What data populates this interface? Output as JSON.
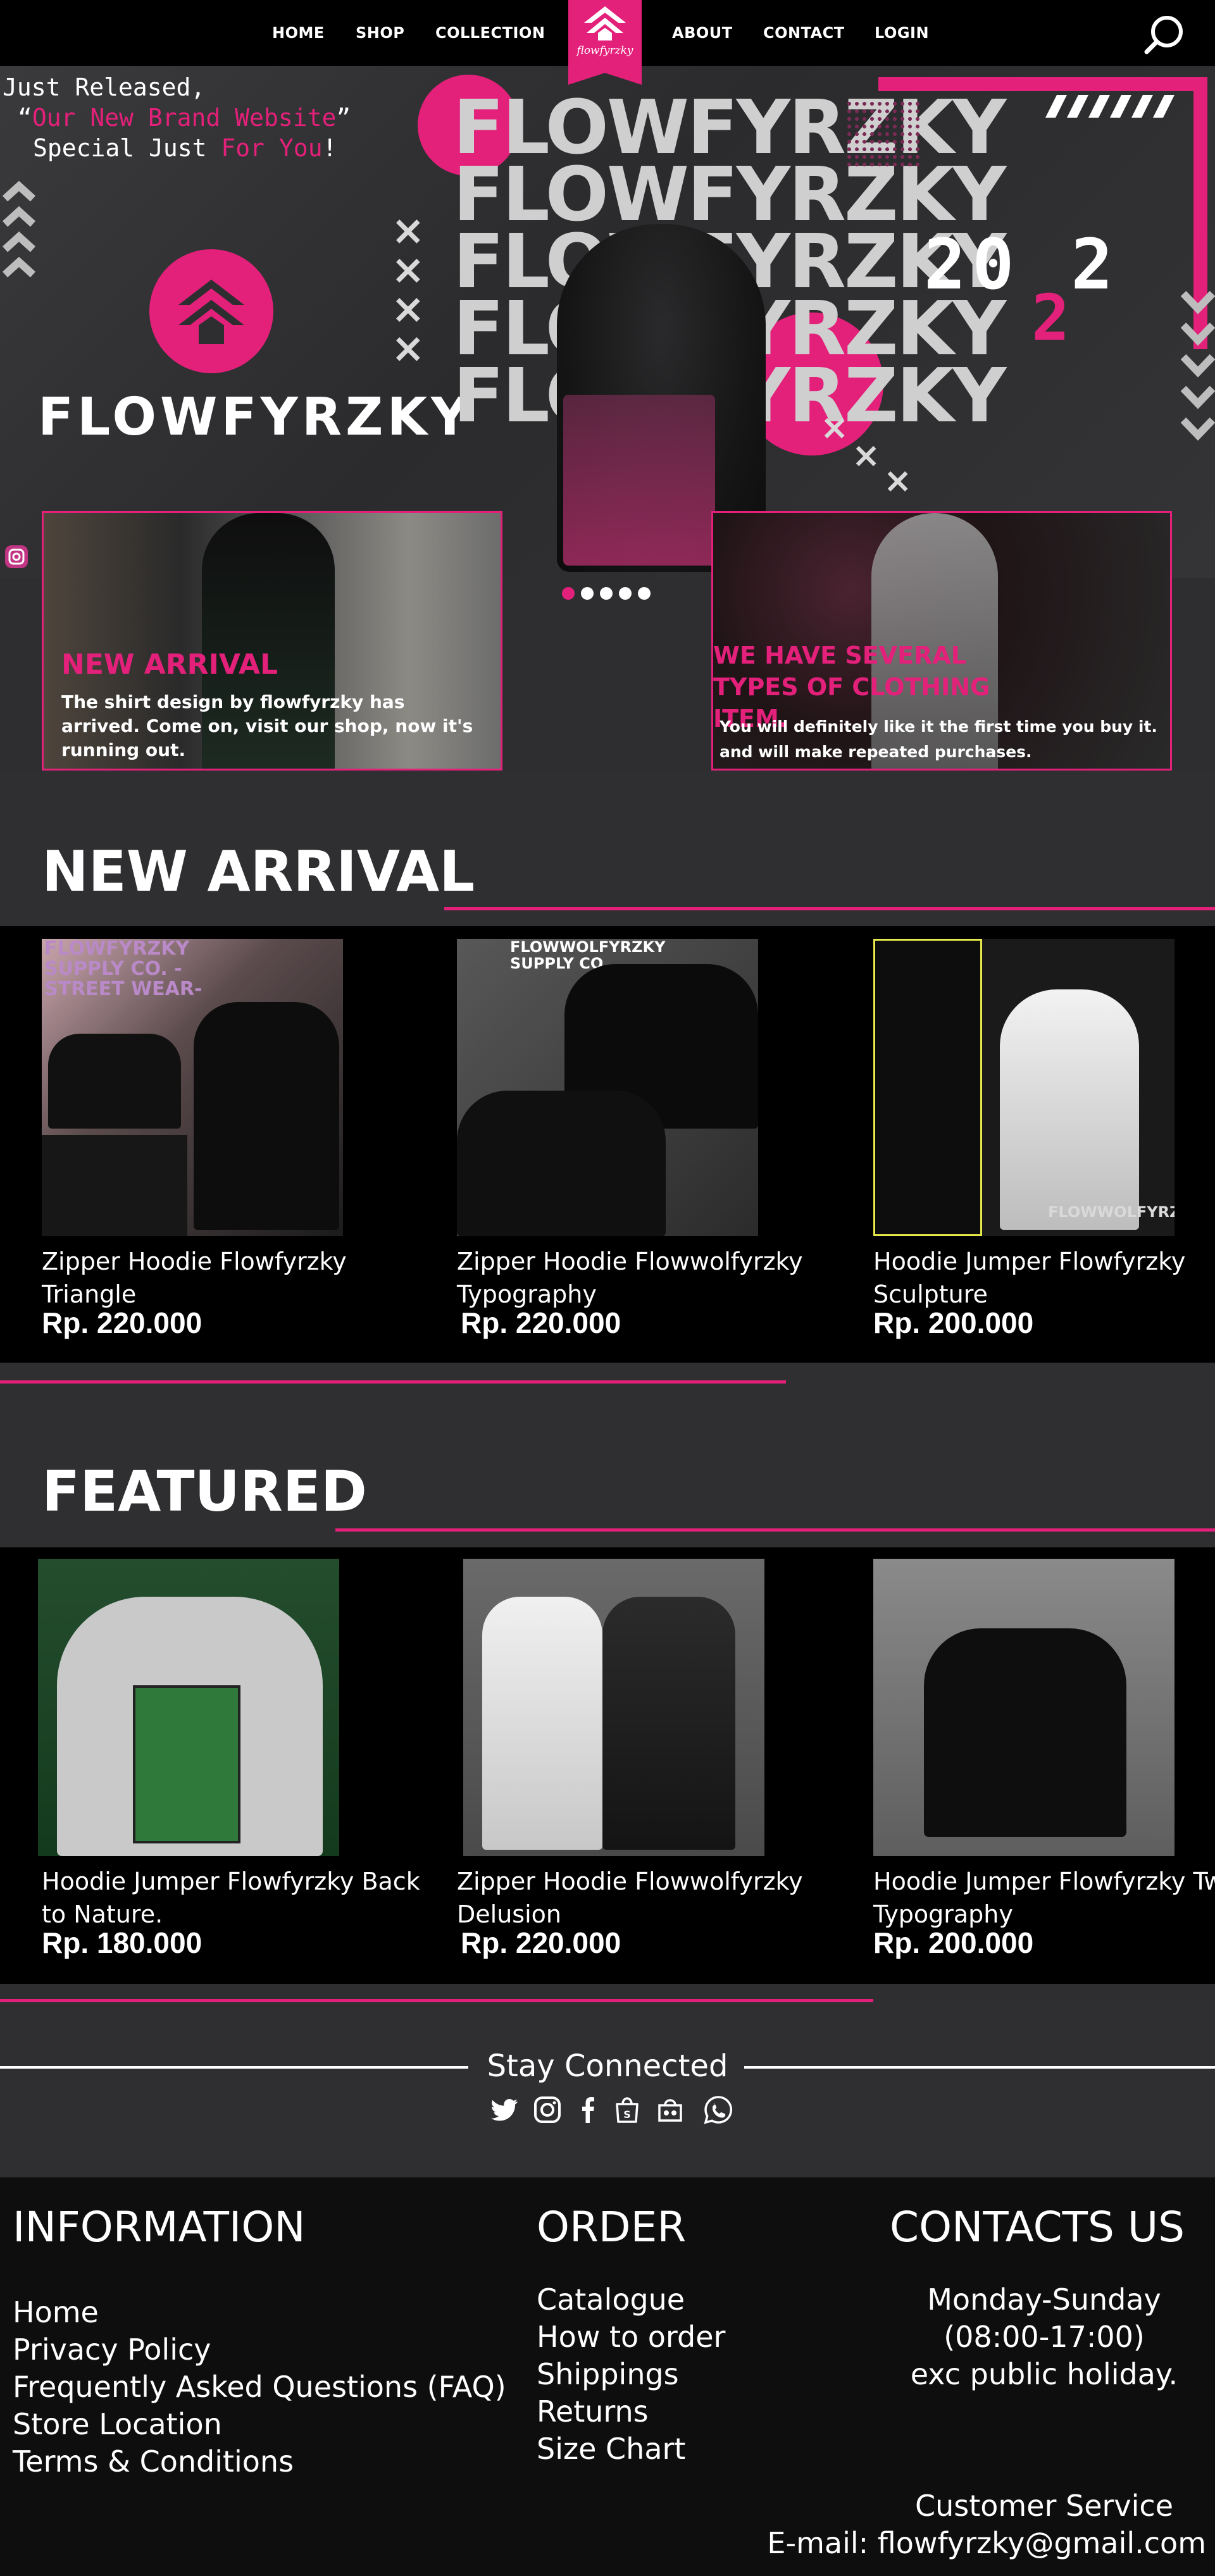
{
  "nav": {
    "items": [
      "HOME",
      "SHOP",
      "COLLECTION",
      "ABOUT",
      "CONTACT",
      "LOGIN"
    ],
    "logo_text": "flowfyrzky"
  },
  "hero": {
    "line1": "Just Released,",
    "line2_a": "“",
    "line2_b": "Our New Brand Website",
    "line2_c": "”",
    "line3_a": "Special Just ",
    "line3_b": "For You",
    "line3_c": "!",
    "brand": "FLOWFYRZKY",
    "stack_word": "FLOWFYRZKY",
    "year_a": "20",
    "year_b": "2",
    "year_c": "2",
    "slides": 5,
    "active_slide": 1
  },
  "cards": [
    {
      "title": "NEW ARRIVAL",
      "text": "The shirt design by flowfyrzky has arrived. Come on, visit our shop, now it's running out."
    },
    {
      "title": "WE HAVE SEVERAL TYPES OF CLOTHING ITEM.",
      "text": "You will definitely like it the first time you buy it. and will make repeated purchases."
    }
  ],
  "new_arrival": {
    "title": "NEW ARRIVAL",
    "products": [
      {
        "name": "Zipper Hoodie Flowfyrzky Triangle",
        "price": "Rp. 220.000",
        "img_text": "FLOWFYRZKY SUPPLY CO. -STREET WEAR-"
      },
      {
        "name": "Zipper Hoodie Flowwolfyrzky Typography",
        "price": "Rp. 220.000",
        "img_text": "FLOWWOLFYRZKY SUPPLY CO."
      },
      {
        "name": "Hoodie Jumper Flowfyrzky Sculpture",
        "price": "Rp. 200.000",
        "img_text": "FLOWWOLFYRZKY"
      }
    ]
  },
  "featured": {
    "title": "FEATURED",
    "products": [
      {
        "name": "Hoodie Jumper Flowfyrzky Back to Nature.",
        "price": "Rp. 180.000"
      },
      {
        "name": "Zipper Hoodie Flowwolfyrzky Delusion",
        "price": "Rp. 220.000"
      },
      {
        "name": "Hoodie Jumper Flowfyrzky Twin Typography",
        "price": "Rp. 200.000"
      }
    ]
  },
  "stay": {
    "title": "Stay Connected",
    "icons": [
      "twitter-icon",
      "instagram-icon",
      "facebook-icon",
      "shopee-icon",
      "tokopedia-icon",
      "whatsapp-icon"
    ]
  },
  "footer": {
    "info_title": "INFORMATION",
    "info_links": [
      "Home",
      "Privacy Policy",
      "Frequently Asked Questions (FAQ)",
      "Store Location",
      "Terms & Conditions"
    ],
    "order_title": "ORDER",
    "order_links": [
      "Catalogue",
      "How to order",
      "Shippings",
      "Returns",
      "Size Chart"
    ],
    "contact_title": "CONTACTS US",
    "hours": [
      "Monday-Sunday",
      "(08:00-17:00)",
      "exc public holiday."
    ],
    "cs_label": "Customer Service",
    "email": "E-mail: flowfyrzky@gmail.com"
  },
  "colors": {
    "accent": "#e3207a",
    "panel": "#2f2f31",
    "black": "#000000"
  }
}
